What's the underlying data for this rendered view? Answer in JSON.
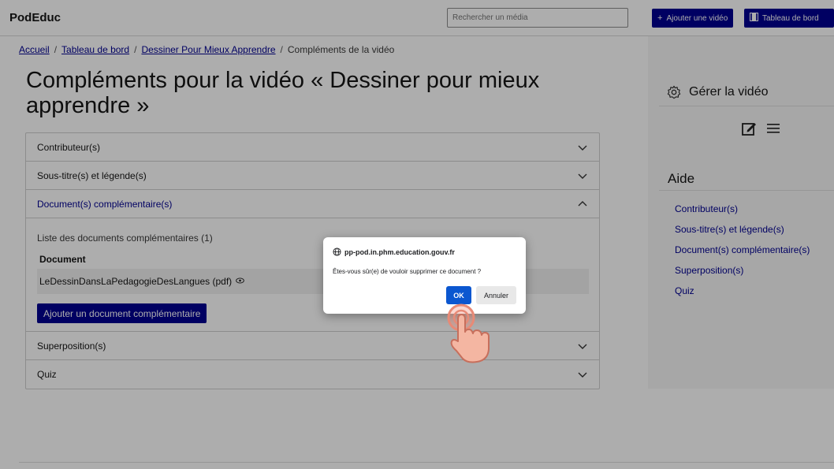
{
  "header": {
    "brand": "PodEduc",
    "search_placeholder": "Rechercher un média",
    "add_video": "Ajouter une vidéo",
    "dashboard": "Tableau de bord"
  },
  "breadcrumb": {
    "home": "Accueil",
    "dashboard": "Tableau de bord",
    "video": "Dessiner Pour Mieux Apprendre",
    "current": "Compléments de la vidéo",
    "separator": "/"
  },
  "page_title": "Compléments pour la vidéo « Dessiner pour mieux apprendre »",
  "accordion": {
    "contributors": "Contributeur(s)",
    "subtitles": "Sous-titre(s) et légende(s)",
    "documents": "Document(s) complémentaire(s)",
    "doc_list_title": "Liste des documents complémentaires (1)",
    "doc_column": "Document",
    "doc_file": "LeDessinDansLaPedagogieDesLangues (pdf)",
    "add_doc": "Ajouter un document complémentaire",
    "overlay": "Superposition(s)",
    "quiz": "Quiz"
  },
  "sidebar": {
    "manage": "Gérer la vidéo",
    "help_title": "Aide",
    "links": [
      "Contributeur(s)",
      "Sous-titre(s) et légende(s)",
      "Document(s) complémentaire(s)",
      "Superposition(s)",
      "Quiz"
    ]
  },
  "dialog": {
    "origin": "pp-pod.in.phm.education.gouv.fr",
    "message": "Êtes-vous sûr(e) de vouloir supprimer ce document ?",
    "ok": "OK",
    "cancel": "Annuler"
  },
  "colors": {
    "primary": "#000091",
    "dialog_ok": "#0b57d0"
  }
}
